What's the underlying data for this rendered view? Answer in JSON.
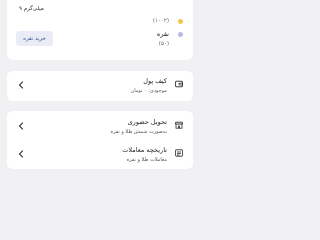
{
  "assets": {
    "gold": {
      "weight": "۹ میلی‌گرم",
      "sub": "(۱۰۰۲)",
      "dot_color": "#f2c744"
    },
    "silver": {
      "name": "نقره",
      "sub": "(۵۰)",
      "buy_label": "خرید نقره",
      "dot_color": "#b6b8e6"
    }
  },
  "menu": {
    "wallet": {
      "title": "کیف پول",
      "subtitle": "موجودی: ۰ تومان",
      "icon": "wallet-icon"
    },
    "in_person": {
      "title": "تحویل حضوری",
      "subtitle": "به‌صورت شمش طلا و نقره",
      "icon": "store-icon"
    },
    "history": {
      "title": "تاریخچه معاملات",
      "subtitle": "معاملات طلا و نقره",
      "icon": "history-icon"
    }
  },
  "colors": {
    "background": "#f1f1f4",
    "card": "#ffffff",
    "accent_button_bg": "#e9ecf6",
    "accent_button_text": "#37508c"
  }
}
